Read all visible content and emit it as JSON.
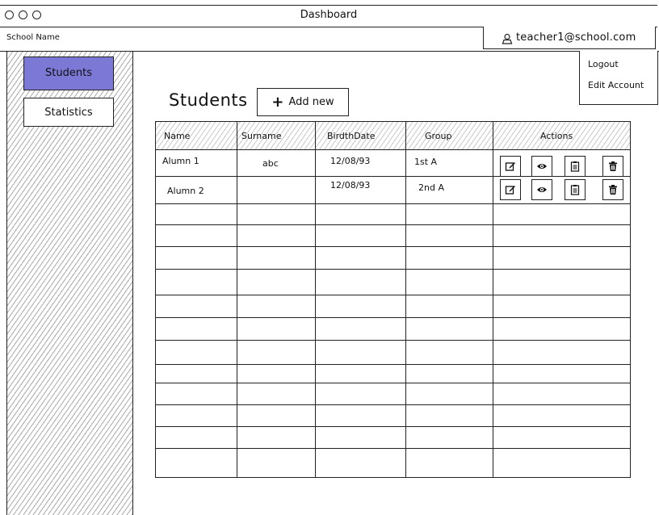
{
  "window": {
    "title": "Dashboard"
  },
  "topbar": {
    "school_name": "School Name",
    "user_email": "teacher1@school.com"
  },
  "user_menu": {
    "items": [
      "Logout",
      "Edit Account"
    ]
  },
  "sidebar": {
    "items": [
      {
        "label": "Students",
        "active": true
      },
      {
        "label": "Statistics",
        "active": false
      }
    ]
  },
  "page": {
    "title": "Students",
    "add_button": "Add new"
  },
  "table": {
    "headers": [
      "Name",
      "Surname",
      "BirdthDate",
      "Group",
      "Actions"
    ],
    "rows": [
      [
        "Alumn 1",
        "abc",
        "12/08/93",
        "1st A"
      ],
      [
        "Alumn 2",
        "",
        "12/08/93",
        "2nd A"
      ]
    ],
    "row_actions": [
      "edit-icon",
      "view-icon",
      "clipboard-icon",
      "trash-icon"
    ]
  },
  "colors": {
    "active_nav": "#7b78d6",
    "border": "#222222"
  }
}
